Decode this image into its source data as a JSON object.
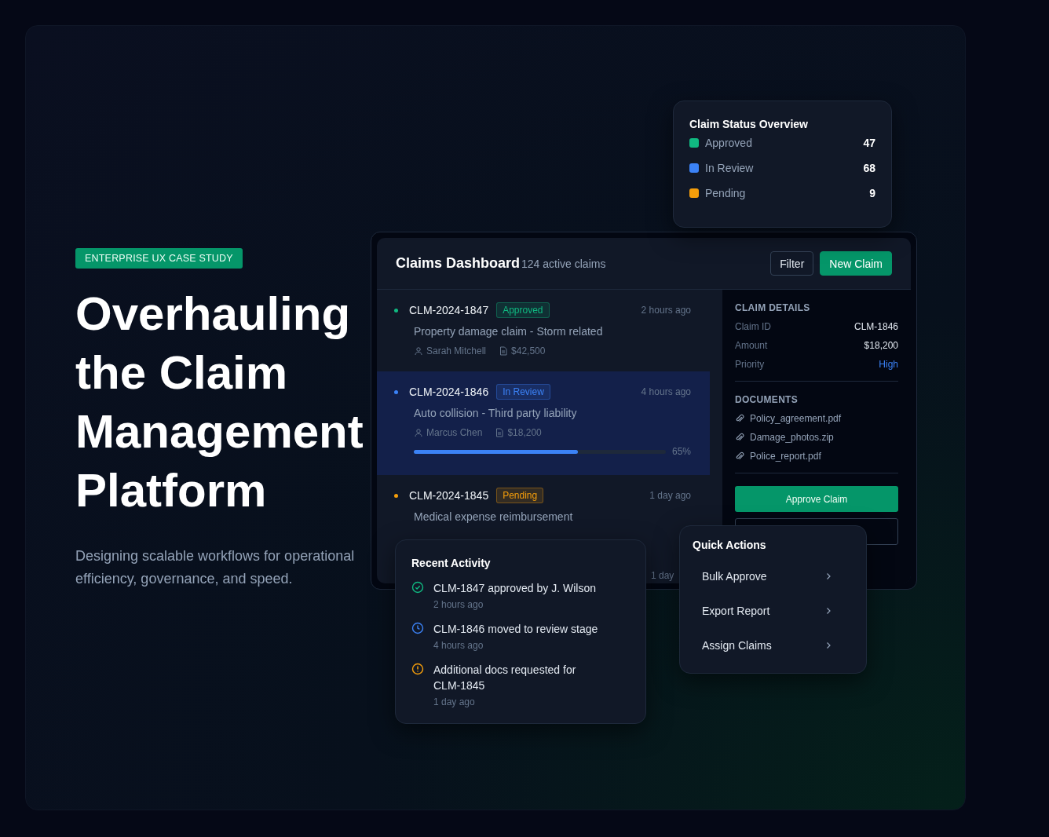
{
  "hero": {
    "badge": "ENTERPRISE UX CASE STUDY",
    "title": "Overhauling the Claim Management Platform",
    "subtitle": "Designing scalable workflows for operational efficiency, governance, and speed."
  },
  "status_overview": {
    "title": "Claim Status Overview",
    "items": [
      {
        "label": "Approved",
        "count": "47",
        "color": "#10b981"
      },
      {
        "label": "In Review",
        "count": "68",
        "color": "#3b82f6"
      },
      {
        "label": "Pending",
        "count": "9",
        "color": "#f59e0b"
      }
    ]
  },
  "dashboard": {
    "title": "Claims Dashboard",
    "subtitle": "124 active claims",
    "buttons": [
      {
        "label": "Filter",
        "kind": "secondary"
      },
      {
        "label": "New Claim",
        "kind": "primary"
      }
    ],
    "claims": [
      {
        "id": "CLM-2024-1847",
        "status": "Approved",
        "color": "#10b981",
        "time": "2 hours ago",
        "description": "Property damage claim - Storm related",
        "person": "Sarah Mitchell",
        "amount": "$42,500",
        "selected": false
      },
      {
        "id": "CLM-2024-1846",
        "status": "In Review",
        "color": "#3b82f6",
        "time": "4 hours ago",
        "description": "Auto collision - Third party liability",
        "person": "Marcus Chen",
        "amount": "$18,200",
        "level": 0.65,
        "reading": "65%",
        "selected": true
      },
      {
        "id": "CLM-2024-1845",
        "status": "Pending",
        "color": "#f59e0b",
        "time": "1 day ago",
        "description": "Medical expense reimbursement",
        "selected": false
      },
      {
        "time": "1 day",
        "selected": false
      }
    ],
    "details": {
      "title": "CLAIM DETAILS",
      "fields": [
        {
          "label": "Claim ID",
          "value": "CLM-1846"
        },
        {
          "label": "Amount",
          "value": "$18,200"
        },
        {
          "label": "Priority",
          "value": "High",
          "kind": "highlight"
        }
      ],
      "documents_title": "DOCUMENTS",
      "documents": [
        "Policy_agreement.pdf",
        "Damage_photos.zip",
        "Police_report.pdf"
      ],
      "approve_button": "Approve Claim"
    }
  },
  "recent_activity": {
    "title": "Recent Activity",
    "items": [
      {
        "kind": "approved",
        "text": "CLM-1847 approved by J. Wilson",
        "time": "2 hours ago"
      },
      {
        "kind": "review",
        "text": "CLM-1846 moved to review stage",
        "time": "4 hours ago"
      },
      {
        "kind": "alert",
        "text": "Additional docs requested for CLM-1845",
        "time": "1 day ago"
      }
    ]
  },
  "quick_actions": {
    "title": "Quick Actions",
    "items": [
      "Bulk Approve",
      "Export Report",
      "Assign Claims"
    ]
  }
}
